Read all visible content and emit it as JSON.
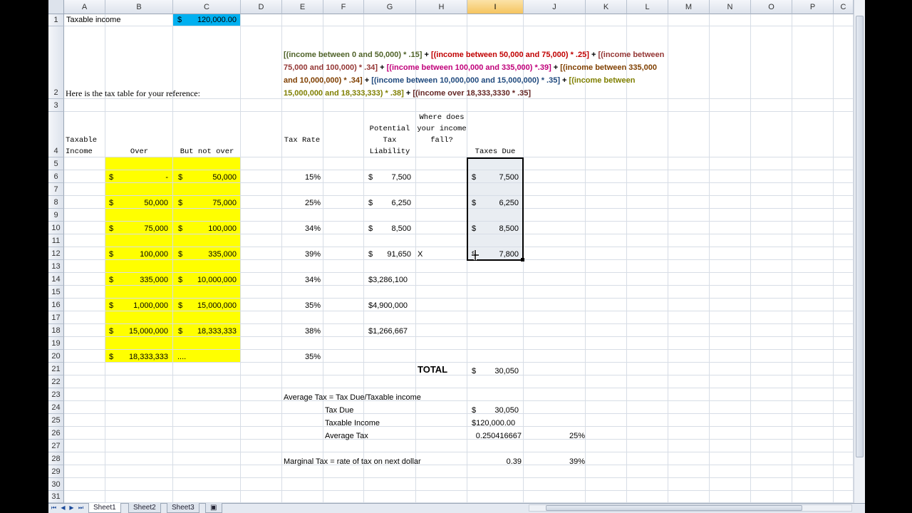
{
  "columns": [
    "A",
    "B",
    "C",
    "D",
    "E",
    "F",
    "G",
    "H",
    "I",
    "J",
    "K",
    "L",
    "M",
    "N",
    "O",
    "P",
    "C"
  ],
  "rows": [
    "1",
    "2",
    "3",
    "4",
    "5",
    "6",
    "7",
    "8",
    "9",
    "10",
    "11",
    "12",
    "13",
    "14",
    "15",
    "16",
    "17",
    "18",
    "19",
    "20",
    "21",
    "22",
    "23",
    "24",
    "25",
    "26",
    "27",
    "28",
    "29",
    "30",
    "31"
  ],
  "row1": {
    "label": "Taxable income",
    "dollar": "$",
    "value": "120,000.00"
  },
  "row2": {
    "label": "Here is the tax table for your reference:"
  },
  "formula": {
    "p1": "[(income between 0 and 50,000)  * .15]",
    "p2": " + ",
    "p3": "[(income between 50,000 and 75,000) * .25]",
    "p4": " + ",
    "p5": "[(income between 75,000 and 100,000) * .34]",
    "p6": " + ",
    "p7": "[(income between 100,000 and 335,000) *.39]",
    "p8": " + ",
    "p9": "[(income between 335,000 and 10,000,000) * .34]",
    "p10": " + ",
    "p11": "[(income between 10,000,000 and 15,000,000) * .35]",
    "p12": " + ",
    "p13": "[(income between 15,000,000 and 18,333,333) * .38]",
    "p14": " + ",
    "p15": "[(income over 18,333,3330 * .35]"
  },
  "formula_colors": {
    "c1": "#4f6228",
    "c2": "#c00000",
    "c3": "#943634",
    "c4": "#c0007a",
    "c5": "#7f3f00",
    "c6": "#1f497d",
    "c7": "#7f7f00",
    "c8": "#632523"
  },
  "headers": {
    "taxable_income": "Taxable Income",
    "over": "Over",
    "but_not_over": "But not over",
    "tax_rate": "Tax Rate",
    "potential": "Potential Tax Liability",
    "where": "Where does your income fall?",
    "taxes_due": "Taxes Due"
  },
  "brackets": [
    {
      "over": "-",
      "not_over": "50,000",
      "rate": "15%",
      "liability": "7,500",
      "where": "",
      "due": "7,500"
    },
    {
      "over": "50,000",
      "not_over": "75,000",
      "rate": "25%",
      "liability": "6,250",
      "where": "",
      "due": "6,250"
    },
    {
      "over": "75,000",
      "not_over": "100,000",
      "rate": "34%",
      "liability": "8,500",
      "where": "",
      "due": "8,500"
    },
    {
      "over": "100,000",
      "not_over": "335,000",
      "rate": "39%",
      "liability": "91,650",
      "where": "X",
      "due": "7,800"
    },
    {
      "over": "335,000",
      "not_over": "10,000,000",
      "rate": "34%",
      "liability": "$3,286,100",
      "where": "",
      "due": ""
    },
    {
      "over": "1,000,000",
      "not_over": "15,000,000",
      "rate": "35%",
      "liability": "$4,900,000",
      "where": "",
      "due": ""
    },
    {
      "over": "15,000,000",
      "not_over": "18,333,333",
      "rate": "38%",
      "liability": "$1,266,667",
      "where": "",
      "due": ""
    },
    {
      "over": "18,333,333",
      "not_over": "....",
      "rate": "35%",
      "liability": "",
      "where": "",
      "due": ""
    }
  ],
  "dollar": "$",
  "total": {
    "label": "TOTAL",
    "dollar": "$",
    "value": "30,050"
  },
  "average": {
    "title": "Average Tax = Tax Due/Taxable income",
    "tax_due_label": "Tax Due",
    "tax_due_dollar": "$",
    "tax_due_value": "30,050",
    "taxable_income_label": "Taxable Income",
    "taxable_income_value": "$120,000.00",
    "average_label": "Average Tax",
    "average_value": "0.250416667",
    "average_pct": "25%"
  },
  "marginal": {
    "title": "Marginal Tax = rate of tax on next dollar",
    "value": "0.39",
    "pct": "39%"
  },
  "sheets": [
    "Sheet1",
    "Sheet2",
    "Sheet3"
  ]
}
